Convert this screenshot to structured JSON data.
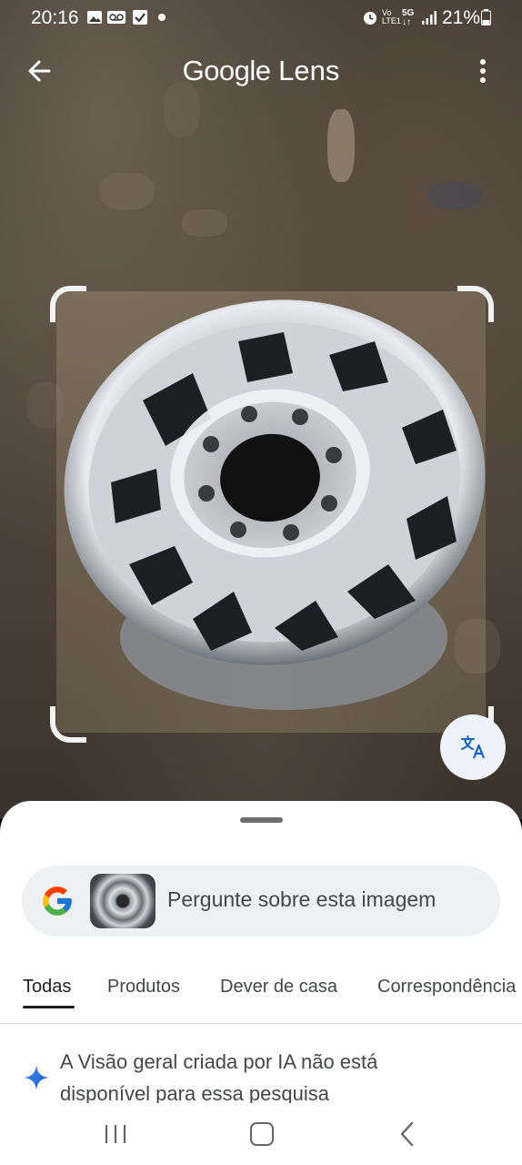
{
  "status_bar": {
    "time": "20:16",
    "battery": "21%"
  },
  "top_bar": {
    "title_brand": "Google",
    "title_product": "Lens"
  },
  "search": {
    "placeholder": "Pergunte sobre esta imagem"
  },
  "tabs": [
    {
      "label": "Todas",
      "active": true
    },
    {
      "label": "Produtos",
      "active": false
    },
    {
      "label": "Dever de casa",
      "active": false
    },
    {
      "label": "Correspondência",
      "active": false
    }
  ],
  "ai_overview": {
    "text": "A Visão geral criada por IA não está disponível para essa pesquisa"
  },
  "icons": [
    "back-arrow-icon",
    "more-vert-icon",
    "translate-icon",
    "google-g-icon",
    "sparkle-icon",
    "recent-apps-icon",
    "home-icon",
    "back-nav-icon"
  ],
  "colors": {
    "accent_blue": "#1a73e8",
    "sheet_bg": "#ffffff",
    "search_bg": "#eff0f3"
  }
}
